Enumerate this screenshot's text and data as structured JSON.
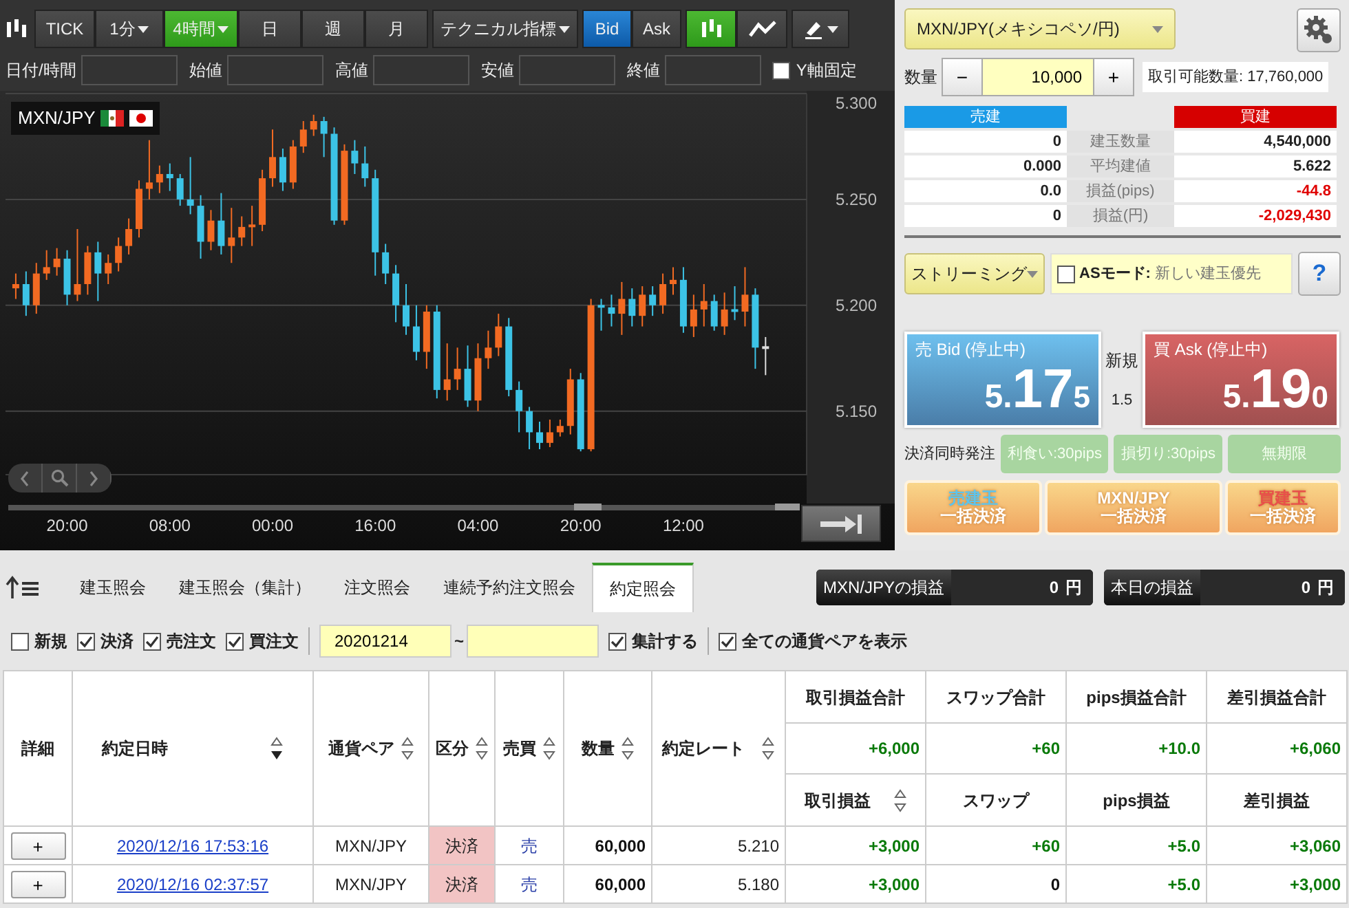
{
  "chart_toolbar": {
    "timeframes": [
      {
        "label": "TICK",
        "selected": false,
        "has_menu": false
      },
      {
        "label": "1分",
        "selected": false,
        "has_menu": true
      },
      {
        "label": "4時間",
        "selected": true,
        "has_menu": true
      },
      {
        "label": "日",
        "selected": false,
        "has_menu": false
      },
      {
        "label": "週",
        "selected": false,
        "has_menu": false
      },
      {
        "label": "月",
        "selected": false,
        "has_menu": false
      }
    ],
    "indicator_menu": {
      "label": "テクニカル指標"
    },
    "price_sides": [
      {
        "label": "Bid",
        "selected": true
      },
      {
        "label": "Ask",
        "selected": false
      }
    ],
    "chart_styles": [
      {
        "kind": "candle",
        "selected": true
      },
      {
        "kind": "line",
        "selected": false
      }
    ]
  },
  "ohlc_fields": [
    {
      "label": "日付/時間"
    },
    {
      "label": "始値"
    },
    {
      "label": "高値"
    },
    {
      "label": "安値"
    },
    {
      "label": "終値"
    }
  ],
  "y_axis_lock": {
    "label": "Y軸固定",
    "checked": false
  },
  "chart": {
    "symbol": "MXN/JPY",
    "chart_data": {
      "type": "candlestick",
      "categories": [
        null,
        null,
        null,
        null,
        null,
        "20:00",
        null,
        null,
        null,
        null,
        null,
        null,
        null,
        null,
        null,
        "08:00",
        null,
        null,
        null,
        null,
        null,
        null,
        null,
        null,
        null,
        "00:00",
        null,
        null,
        null,
        null,
        null,
        null,
        null,
        null,
        null,
        "16:00",
        null,
        null,
        null,
        null,
        null,
        null,
        null,
        null,
        null,
        "04:00",
        null,
        null,
        null,
        null,
        null,
        null,
        null,
        null,
        null,
        "20:00",
        null,
        null,
        null,
        null,
        null,
        null,
        null,
        null,
        null,
        "12:00",
        null,
        null,
        null,
        null,
        null,
        null,
        null,
        null
      ],
      "ohlc": [
        [
          5.208,
          5.215,
          5.203,
          5.21
        ],
        [
          5.21,
          5.216,
          5.195,
          5.2
        ],
        [
          5.2,
          5.22,
          5.196,
          5.215
        ],
        [
          5.215,
          5.226,
          5.212,
          5.218
        ],
        [
          5.218,
          5.227,
          5.214,
          5.222
        ],
        [
          5.222,
          5.226,
          5.2,
          5.205
        ],
        [
          5.205,
          5.236,
          5.202,
          5.21
        ],
        [
          5.21,
          5.228,
          5.205,
          5.225
        ],
        [
          5.225,
          5.23,
          5.202,
          5.215
        ],
        [
          5.215,
          5.224,
          5.21,
          5.22
        ],
        [
          5.22,
          5.232,
          5.216,
          5.228
        ],
        [
          5.228,
          5.241,
          5.224,
          5.236
        ],
        [
          5.236,
          5.259,
          5.232,
          5.255
        ],
        [
          5.255,
          5.278,
          5.25,
          5.258
        ],
        [
          5.258,
          5.266,
          5.253,
          5.262
        ],
        [
          5.262,
          5.267,
          5.254,
          5.26
        ],
        [
          5.26,
          5.262,
          5.247,
          5.25
        ],
        [
          5.25,
          5.27,
          5.243,
          5.247
        ],
        [
          5.247,
          5.252,
          5.222,
          5.23
        ],
        [
          5.23,
          5.245,
          5.226,
          5.24
        ],
        [
          5.24,
          5.253,
          5.224,
          5.228
        ],
        [
          5.228,
          5.246,
          5.22,
          5.232
        ],
        [
          5.232,
          5.242,
          5.228,
          5.237
        ],
        [
          5.237,
          5.247,
          5.228,
          5.238
        ],
        [
          5.238,
          5.264,
          5.235,
          5.26
        ],
        [
          5.26,
          5.283,
          5.256,
          5.27
        ],
        [
          5.27,
          5.274,
          5.254,
          5.258
        ],
        [
          5.258,
          5.278,
          5.255,
          5.275
        ],
        [
          5.275,
          5.287,
          5.272,
          5.283
        ],
        [
          5.283,
          5.29,
          5.28,
          5.287
        ],
        [
          5.287,
          5.289,
          5.27,
          5.281
        ],
        [
          5.281,
          5.284,
          5.238,
          5.24
        ],
        [
          5.24,
          5.276,
          5.238,
          5.273
        ],
        [
          5.273,
          5.278,
          5.262,
          5.267
        ],
        [
          5.267,
          5.275,
          5.256,
          5.26
        ],
        [
          5.26,
          5.264,
          5.214,
          5.225
        ],
        [
          5.225,
          5.229,
          5.21,
          5.215
        ],
        [
          5.215,
          5.219,
          5.192,
          5.2
        ],
        [
          5.2,
          5.21,
          5.186,
          5.19
        ],
        [
          5.19,
          5.2,
          5.174,
          5.178
        ],
        [
          5.178,
          5.2,
          5.17,
          5.197
        ],
        [
          5.197,
          5.2,
          5.156,
          5.16
        ],
        [
          5.16,
          5.182,
          5.155,
          5.165
        ],
        [
          5.165,
          5.18,
          5.16,
          5.17
        ],
        [
          5.17,
          5.181,
          5.152,
          5.155
        ],
        [
          5.155,
          5.182,
          5.15,
          5.175
        ],
        [
          5.175,
          5.188,
          5.17,
          5.18
        ],
        [
          5.18,
          5.196,
          5.176,
          5.19
        ],
        [
          5.19,
          5.194,
          5.157,
          5.16
        ],
        [
          5.16,
          5.164,
          5.14,
          5.15
        ],
        [
          5.15,
          5.152,
          5.132,
          5.14
        ],
        [
          5.14,
          5.145,
          5.132,
          5.135
        ],
        [
          5.135,
          5.146,
          5.133,
          5.14
        ],
        [
          5.14,
          5.146,
          5.138,
          5.143
        ],
        [
          5.143,
          5.17,
          5.139,
          5.165
        ],
        [
          5.165,
          5.168,
          5.131,
          5.132
        ],
        [
          5.132,
          5.203,
          5.131,
          5.2
        ],
        [
          5.2,
          5.203,
          5.188,
          5.199
        ],
        [
          5.199,
          5.205,
          5.19,
          5.196
        ],
        [
          5.196,
          5.211,
          5.186,
          5.203
        ],
        [
          5.203,
          5.208,
          5.19,
          5.195
        ],
        [
          5.195,
          5.209,
          5.19,
          5.205
        ],
        [
          5.205,
          5.209,
          5.195,
          5.2
        ],
        [
          5.2,
          5.215,
          5.196,
          5.21
        ],
        [
          5.21,
          5.218,
          5.205,
          5.212
        ],
        [
          5.212,
          5.218,
          5.187,
          5.19
        ],
        [
          5.19,
          5.205,
          5.185,
          5.198
        ],
        [
          5.198,
          5.21,
          5.19,
          5.202
        ],
        [
          5.202,
          5.205,
          5.188,
          5.19
        ],
        [
          5.19,
          5.206,
          5.186,
          5.198
        ],
        [
          5.198,
          5.209,
          5.193,
          5.197
        ],
        [
          5.197,
          5.218,
          5.19,
          5.205
        ],
        [
          5.205,
          5.208,
          5.17,
          5.18
        ],
        [
          5.18,
          5.185,
          5.167,
          5.18
        ]
      ],
      "grid": true,
      "ylim": [
        5.12,
        5.3
      ],
      "yticks": [
        {
          "value": 5.3,
          "label": "5.300"
        },
        {
          "value": 5.25,
          "label": "5.250"
        },
        {
          "value": 5.2,
          "label": "5.200"
        },
        {
          "value": 5.15,
          "label": "5.150"
        }
      ]
    }
  },
  "order_panel": {
    "currency": "MXN/JPY(メキシコペソ/円)",
    "quantity_label": "数量",
    "decrement": "−",
    "quantity": "10,000",
    "increment": "+",
    "available": "取引可能数量: 17,760,000",
    "sell_header": "売建",
    "buy_header": "買建",
    "positions": [
      {
        "sell": "0",
        "label": "建玉数量",
        "buy": "4,540,000",
        "negative": false
      },
      {
        "sell": "0.000",
        "label": "平均建値",
        "buy": "5.622",
        "negative": false
      },
      {
        "sell": "0.0",
        "label": "損益(pips)",
        "buy": "-44.8",
        "negative": true
      },
      {
        "sell": "0",
        "label": "損益(円)",
        "buy": "-2,029,430",
        "negative": true
      }
    ],
    "mode": "ストリーミング",
    "as_mode": {
      "label": "ASモード:",
      "checked": false,
      "placeholder": "新しい建玉優先"
    },
    "help": "?",
    "bid": {
      "title": "売 Bid (停止中)",
      "lead": "5.",
      "pips": "17",
      "fraction": "5"
    },
    "spread_label": "新規",
    "spread": "1.5",
    "ask": {
      "title": "買 Ask (停止中)",
      "lead": "5.",
      "pips": "19",
      "fraction": "0"
    },
    "settle_label": "決済同時発注",
    "settle_options": [
      "利食い:30pips",
      "損切り:30pips",
      "無期限"
    ],
    "bulk_buttons": [
      {
        "title": "売建玉",
        "subtitle": "一括決済",
        "color": "#5ec4ec"
      },
      {
        "title": "MXN/JPY",
        "subtitle": "一括決済",
        "color": "#ffffff"
      },
      {
        "title": "買建玉",
        "subtitle": "一括決済",
        "color": "#e8504a"
      }
    ]
  },
  "tabs": [
    {
      "label": "建玉照会",
      "selected": false
    },
    {
      "label": "建玉照会（集計）",
      "selected": false
    },
    {
      "label": "注文照会",
      "selected": false
    },
    {
      "label": "連続予約注文照会",
      "selected": false
    },
    {
      "label": "約定照会",
      "selected": true
    }
  ],
  "pl_boxes": [
    {
      "label": "MXN/JPYの損益",
      "value": "0",
      "unit": "円"
    },
    {
      "label": "本日の損益",
      "value": "0",
      "unit": "円"
    }
  ],
  "filters": [
    {
      "label": "新規",
      "checked": false
    },
    {
      "label": "決済",
      "checked": true
    },
    {
      "label": "売注文",
      "checked": true
    },
    {
      "label": "買注文",
      "checked": true
    }
  ],
  "date_from": "20201214",
  "range_separator": "~",
  "summary_check": {
    "label": "集計する",
    "checked": true
  },
  "all_pairs_check": {
    "label": "全ての通貨ペアを表示",
    "checked": true
  },
  "table": {
    "columns": [
      {
        "label": "詳細",
        "sortable": false
      },
      {
        "label": "約定日時",
        "sortable": true,
        "sort_desc": true
      },
      {
        "label": "通貨ペア",
        "sortable": true,
        "sort_desc": false
      },
      {
        "label": "区分",
        "sortable": true,
        "sort_desc": false
      },
      {
        "label": "売買",
        "sortable": true,
        "sort_desc": false
      },
      {
        "label": "数量",
        "sortable": true,
        "sort_desc": false
      },
      {
        "label": "約定レート",
        "sortable": true,
        "sort_desc": false
      }
    ],
    "summary_columns": [
      {
        "total_label": "取引損益合計",
        "total": "+6,000",
        "label": "取引損益",
        "sortable": true
      },
      {
        "total_label": "スワップ合計",
        "total": "+60",
        "label": "スワップ",
        "sortable": false
      },
      {
        "total_label": "pips損益合計",
        "total": "+10.0",
        "label": "pips損益",
        "sortable": false
      },
      {
        "total_label": "差引損益合計",
        "total": "+6,060",
        "label": "差引損益",
        "sortable": false
      }
    ],
    "rows": [
      {
        "detail": "+",
        "datetime": "2020/12/16 17:53:16",
        "pair": "MXN/JPY",
        "type": "決済",
        "side": "売",
        "qty": "60,000",
        "rate": "5.210",
        "values": [
          {
            "text": "+3,000",
            "positive": true
          },
          {
            "text": "+60",
            "positive": true
          },
          {
            "text": "+5.0",
            "positive": true
          },
          {
            "text": "+3,060",
            "positive": true
          }
        ]
      },
      {
        "detail": "+",
        "datetime": "2020/12/16 02:37:57",
        "pair": "MXN/JPY",
        "type": "決済",
        "side": "売",
        "qty": "60,000",
        "rate": "5.180",
        "values": [
          {
            "text": "+3,000",
            "positive": true
          },
          {
            "text": "0",
            "positive": false
          },
          {
            "text": "+5.0",
            "positive": true
          },
          {
            "text": "+3,000",
            "positive": true
          }
        ]
      }
    ]
  }
}
